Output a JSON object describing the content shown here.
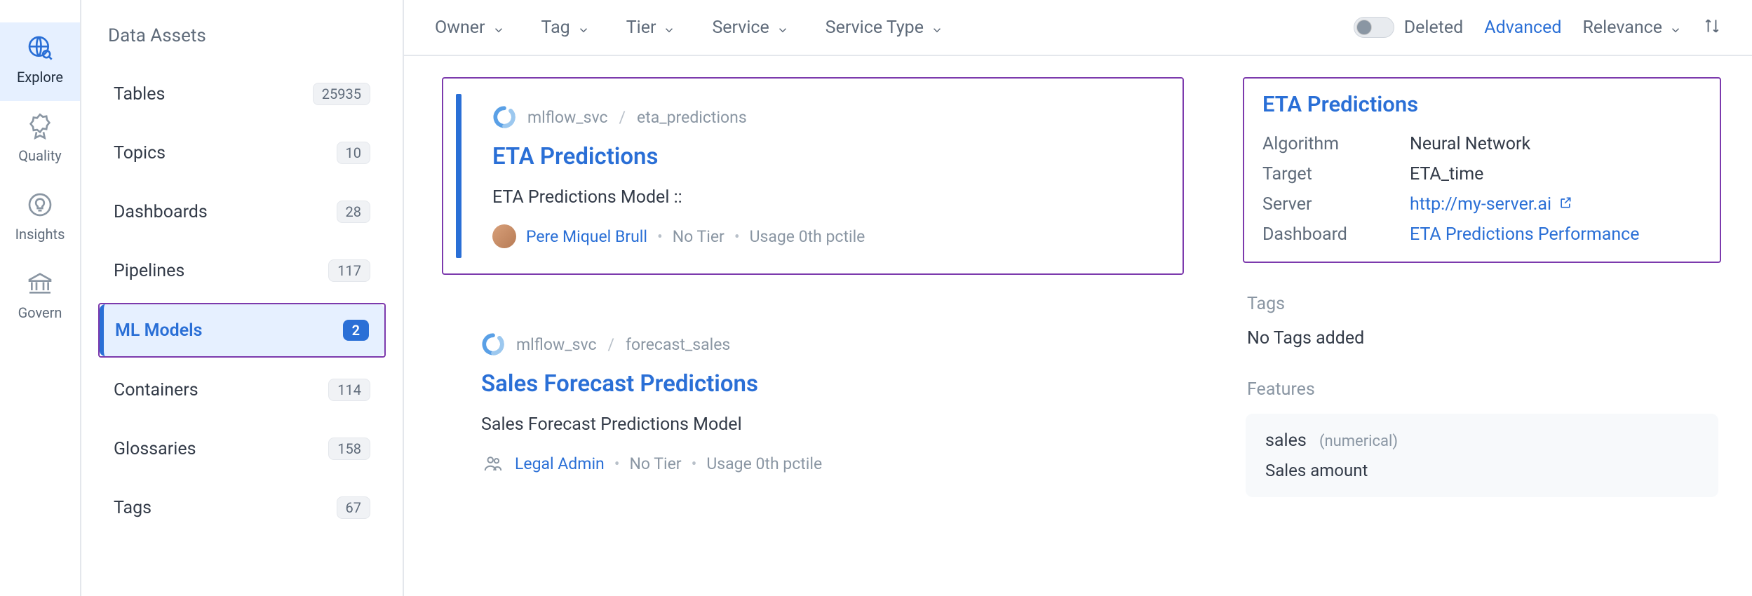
{
  "rail": {
    "items": [
      {
        "label": "Explore"
      },
      {
        "label": "Quality"
      },
      {
        "label": "Insights"
      },
      {
        "label": "Govern"
      }
    ]
  },
  "sidebar": {
    "title": "Data Assets",
    "items": [
      {
        "label": "Tables",
        "count": "25935"
      },
      {
        "label": "Topics",
        "count": "10"
      },
      {
        "label": "Dashboards",
        "count": "28"
      },
      {
        "label": "Pipelines",
        "count": "117"
      },
      {
        "label": "ML Models",
        "count": "2"
      },
      {
        "label": "Containers",
        "count": "114"
      },
      {
        "label": "Glossaries",
        "count": "158"
      },
      {
        "label": "Tags",
        "count": "67"
      }
    ]
  },
  "toolbar": {
    "filters": [
      {
        "label": "Owner"
      },
      {
        "label": "Tag"
      },
      {
        "label": "Tier"
      },
      {
        "label": "Service"
      },
      {
        "label": "Service Type"
      }
    ],
    "deleted_label": "Deleted",
    "advanced_label": "Advanced",
    "relevance_label": "Relevance"
  },
  "results": [
    {
      "service": "mlflow_svc",
      "fqn": "eta_predictions",
      "title": "ETA Predictions",
      "desc": "ETA Predictions Model ::",
      "owner": "Pere Miquel Brull",
      "tier": "No Tier",
      "usage": "Usage 0th pctile"
    },
    {
      "service": "mlflow_svc",
      "fqn": "forecast_sales",
      "title": "Sales Forecast Predictions",
      "desc": "Sales Forecast Predictions Model",
      "owner": "Legal Admin",
      "tier": "No Tier",
      "usage": "Usage 0th pctile"
    }
  ],
  "details": {
    "title": "ETA Predictions",
    "algorithm_label": "Algorithm",
    "algorithm_value": "Neural Network",
    "target_label": "Target",
    "target_value": "ETA_time",
    "server_label": "Server",
    "server_value": "http://my-server.ai",
    "dashboard_label": "Dashboard",
    "dashboard_value": "ETA Predictions Performance",
    "tags_label": "Tags",
    "tags_value": "No Tags added",
    "features_label": "Features",
    "feature": {
      "name": "sales",
      "type": "(numerical)",
      "desc": "Sales amount"
    }
  }
}
